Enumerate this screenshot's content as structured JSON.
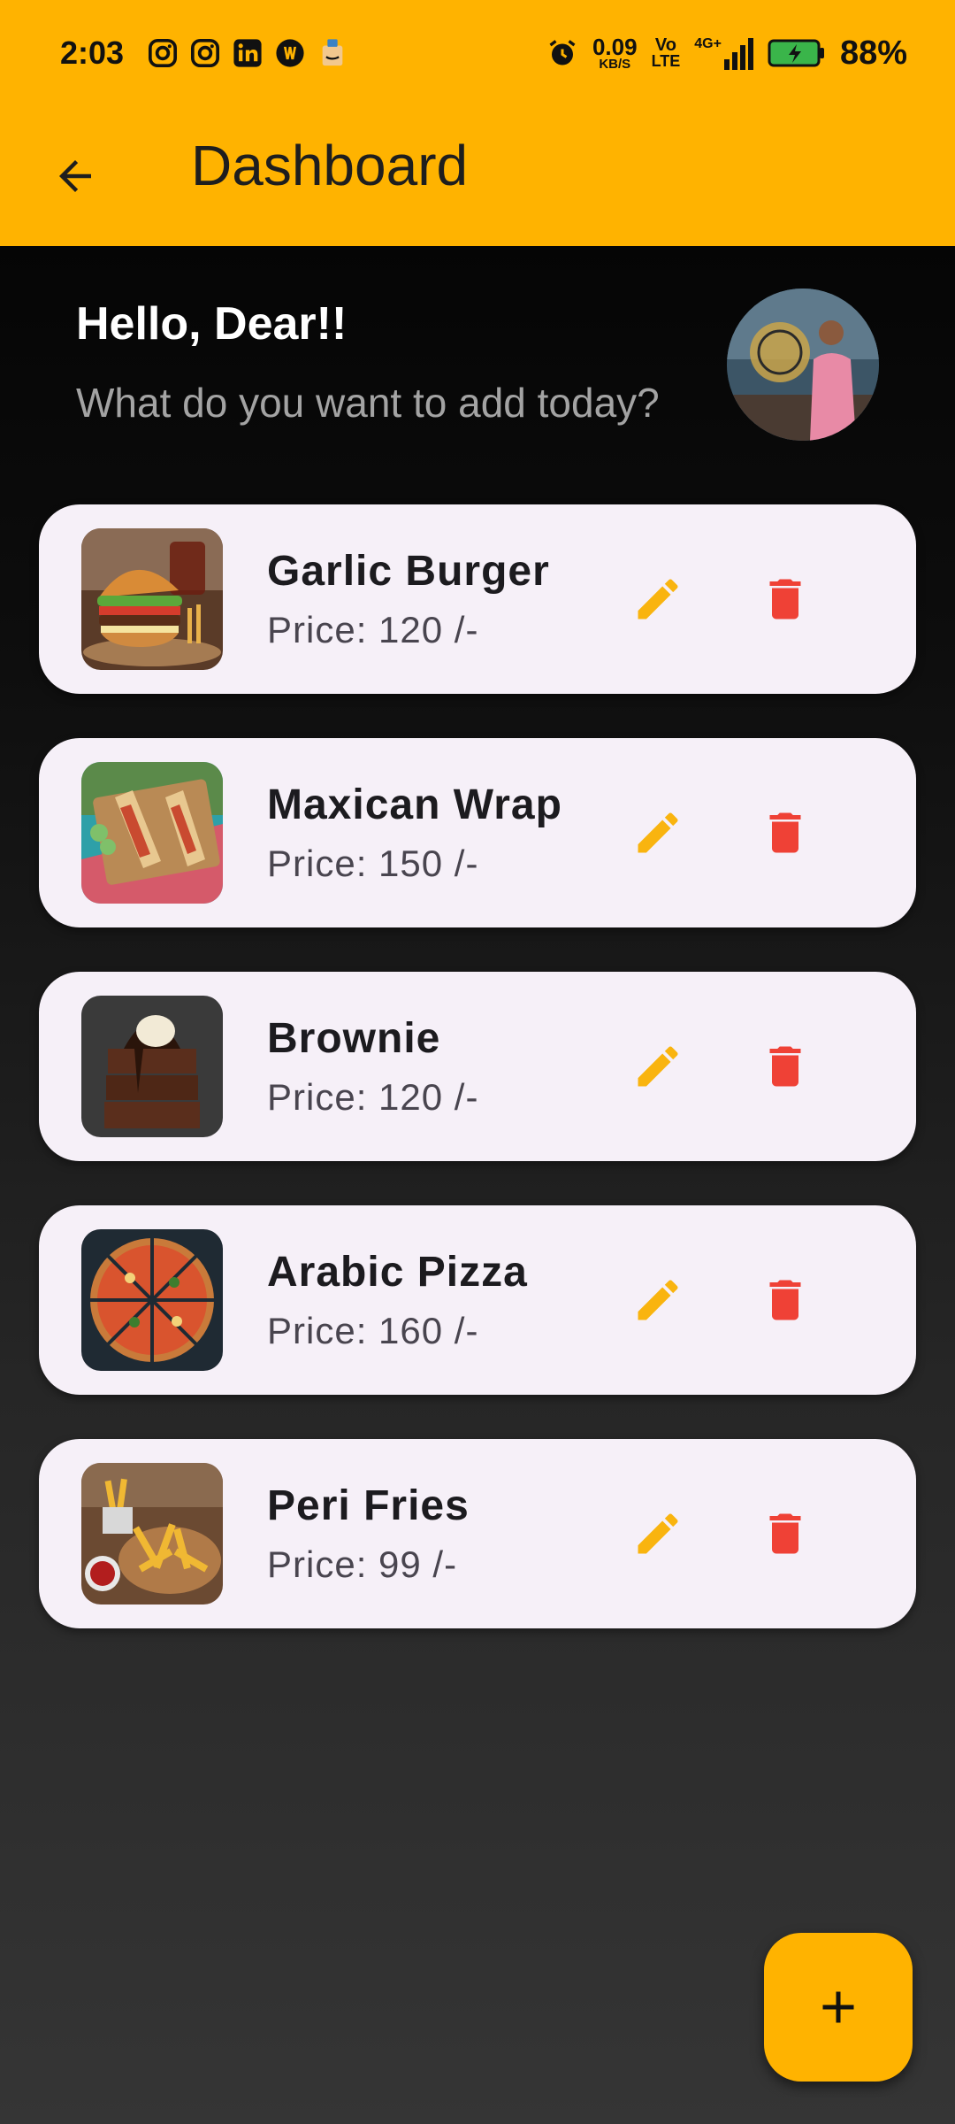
{
  "status_bar": {
    "time": "2:03",
    "left_icons": [
      "instagram-icon",
      "instagram-icon",
      "linkedin-icon",
      "app-icon",
      "amazon-icon"
    ],
    "speed_value": "0.09",
    "speed_unit": "KB/S",
    "volte_top": "Vo",
    "volte_bottom": "LTE",
    "network": "4G+",
    "battery": "88%"
  },
  "app_bar": {
    "title": "Dashboard",
    "back_icon": "arrow-back-icon"
  },
  "header": {
    "greeting": "Hello, Dear!!",
    "prompt": "What do you want to add today?"
  },
  "items": [
    {
      "name": "Garlic Burger",
      "price": "Price: 120 /-",
      "image": "burger"
    },
    {
      "name": "Maxican Wrap",
      "price": "Price: 150 /-",
      "image": "wrap"
    },
    {
      "name": "Brownie",
      "price": "Price: 120 /-",
      "image": "brownie"
    },
    {
      "name": "Arabic Pizza",
      "price": "Price: 160 /-",
      "image": "pizza"
    },
    {
      "name": "Peri Fries",
      "price": "Price: 99 /-",
      "image": "fries"
    }
  ],
  "colors": {
    "accent": "#FFB300",
    "edit": "#F9B40F",
    "delete": "#EF4136",
    "card": "#F6F0F8"
  }
}
